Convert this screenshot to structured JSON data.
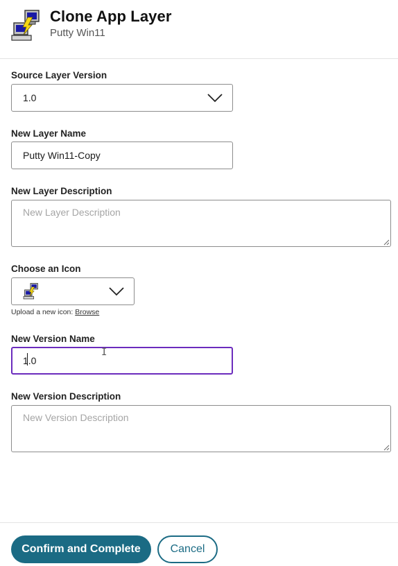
{
  "header": {
    "title": "Clone App Layer",
    "subtitle": "Putty Win11",
    "icon": "putty-computer-icon"
  },
  "form": {
    "source_layer_version": {
      "label": "Source Layer Version",
      "value": "1.0"
    },
    "new_layer_name": {
      "label": "New Layer Name",
      "value": "Putty Win11-Copy"
    },
    "new_layer_description": {
      "label": "New Layer Description",
      "placeholder": "New Layer Description",
      "value": ""
    },
    "choose_icon": {
      "label": "Choose an Icon",
      "selected_icon": "putty-computer-icon",
      "helper_text": "Upload a new icon: ",
      "browse_link": "Browse"
    },
    "new_version_name": {
      "label": "New Version Name",
      "value": "1.0",
      "focused": true
    },
    "new_version_description": {
      "label": "New Version Description",
      "placeholder": "New Version Description",
      "value": ""
    }
  },
  "footer": {
    "confirm_label": "Confirm and Complete",
    "cancel_label": "Cancel"
  },
  "colors": {
    "primary": "#1b6b84",
    "focus": "#6b2bbd"
  }
}
